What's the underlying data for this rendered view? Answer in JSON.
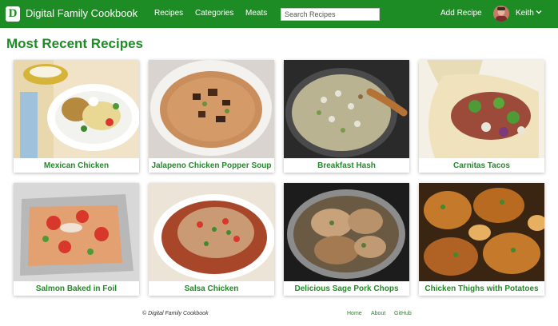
{
  "header": {
    "logo_letter": "D",
    "brand": "Digital Family Cookbook",
    "nav": [
      "Recipes",
      "Categories",
      "Meats"
    ],
    "search_placeholder": "Search Recipes",
    "add_recipe": "Add Recipe",
    "user_name": "Keith"
  },
  "main": {
    "title": "Most Recent Recipes",
    "recipes": [
      {
        "title": "Mexican Chicken"
      },
      {
        "title": "Jalapeno Chicken Popper Soup"
      },
      {
        "title": "Breakfast Hash"
      },
      {
        "title": "Carnitas Tacos"
      },
      {
        "title": "Salmon Baked in Foil"
      },
      {
        "title": "Salsa Chicken"
      },
      {
        "title": "Delicious Sage Pork Chops"
      },
      {
        "title": "Chicken Thighs with Potatoes"
      }
    ]
  },
  "footer": {
    "copyright": "© Digital Family Cookbook",
    "links": [
      "Home",
      "About",
      "GitHub"
    ]
  },
  "colors": {
    "brand_green": "#1e8c24",
    "navbar_text": "#ffffff"
  }
}
